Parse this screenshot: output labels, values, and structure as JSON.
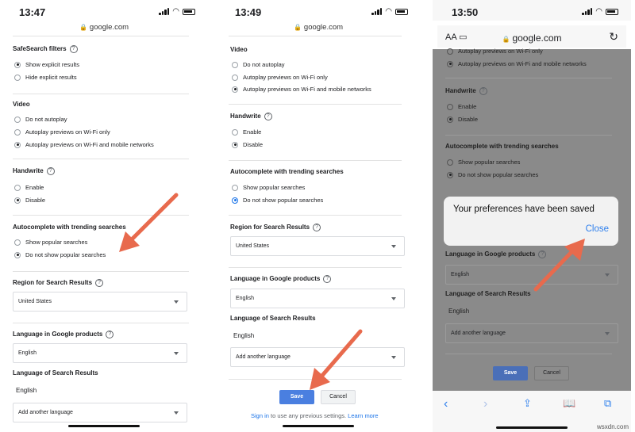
{
  "panel1": {
    "time": "13:47",
    "url": "google.com",
    "safesearch": {
      "title": "SafeSearch filters",
      "options": [
        "Show explicit results",
        "Hide explicit results"
      ],
      "selected": 0
    },
    "video": {
      "title": "Video",
      "options": [
        "Do not autoplay",
        "Autoplay previews on Wi-Fi only",
        "Autoplay previews on Wi-Fi and mobile networks"
      ],
      "selected": 2
    },
    "handwrite": {
      "title": "Handwrite",
      "options": [
        "Enable",
        "Disable"
      ],
      "selected": 1
    },
    "autocomplete": {
      "title": "Autocomplete with trending searches",
      "options": [
        "Show popular searches",
        "Do not show popular searches"
      ],
      "selected": 1
    },
    "region": {
      "title": "Region for Search Results",
      "value": "United States"
    },
    "language_products": {
      "title": "Language in Google products",
      "value": "English"
    },
    "language_results": {
      "title": "Language of Search Results",
      "current": "English",
      "add_placeholder": "Add another language"
    }
  },
  "panel2": {
    "time": "13:49",
    "url": "google.com",
    "video": {
      "title": "Video",
      "options": [
        "Do not autoplay",
        "Autoplay previews on Wi-Fi only",
        "Autoplay previews on Wi-Fi and mobile networks"
      ],
      "selected": 2
    },
    "handwrite": {
      "title": "Handwrite",
      "options": [
        "Enable",
        "Disable"
      ],
      "selected": 1
    },
    "autocomplete": {
      "title": "Autocomplete with trending searches",
      "options": [
        "Show popular searches",
        "Do not show popular searches"
      ],
      "selected": 1
    },
    "region": {
      "title": "Region for Search Results",
      "value": "United States"
    },
    "language_products": {
      "title": "Language in Google products",
      "value": "English"
    },
    "language_results": {
      "title": "Language of Search Results",
      "current": "English",
      "add_placeholder": "Add another language"
    },
    "save_label": "Save",
    "cancel_label": "Cancel",
    "signin_link": "Sign in",
    "signin_text": " to use any previous settings. ",
    "learn_more": "Learn more"
  },
  "panel3": {
    "time": "13:50",
    "aa": "AA",
    "url": "google.com",
    "video_option": "Autoplay previews on Wi-Fi and mobile networks",
    "video_option_top": "Autoplay previews on Wi-Fi only",
    "handwrite": {
      "title": "Handwrite",
      "options": [
        "Enable",
        "Disable"
      ],
      "selected": 1
    },
    "autocomplete": {
      "title": "Autocomplete with trending searches",
      "options": [
        "Show popular searches",
        "Do not show popular searches"
      ],
      "selected": 1
    },
    "language_products": {
      "title": "Language in Google products",
      "value": "English"
    },
    "language_results": {
      "title": "Language of Search Results",
      "current": "English",
      "add_placeholder": "Add another language"
    },
    "save_label": "Save",
    "cancel_label": "Cancel",
    "dialog_message": "Your preferences have been saved",
    "dialog_close": "Close"
  },
  "colors": {
    "arrow": "#e86a4d",
    "save": "#4a7fe0",
    "link": "#1a73e8",
    "ios_blue": "#2f80ed"
  },
  "watermark": "wsxdn.com"
}
